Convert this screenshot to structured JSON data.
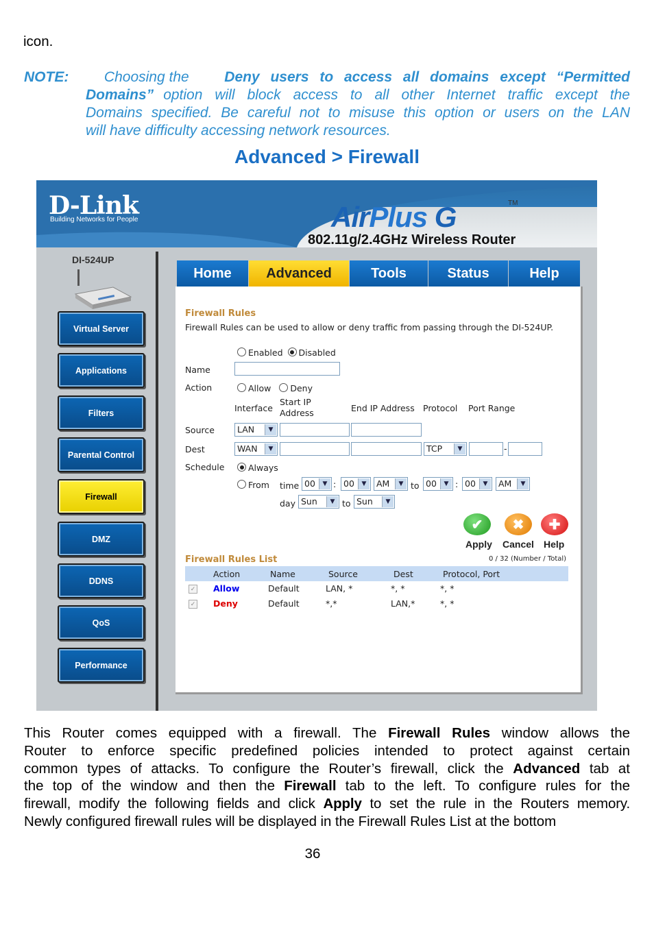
{
  "doc": {
    "top_fragment": "icon.",
    "note_label": "NOTE:",
    "note_line1_a": "Choosing the",
    "note_line1_b": "Deny users to access all domains except “Permitted",
    "note_line2_a": "Domains”",
    "note_line2_b": "option will block access to all other Internet traffic except the",
    "note_line3": "Domains specified. Be careful not to misuse this option or users on the LAN",
    "note_line4": "will have difficulty accessing network resources.",
    "section_title": "Advanced > Firewall",
    "para": {
      "l1_a": "This Router comes equipped with a firewall. The",
      "l1_b": "Firewall Rules",
      "l1_c": "window allows the",
      "l2": "Router to enforce specific predefined policies intended to protect against certain",
      "l3_a": "common types of attacks. To configure the Router’s firewall, click the",
      "l3_b": "Advanced",
      "l3_c": "tab at",
      "l4_a": "the top of the window and then the",
      "l4_b": "Firewall",
      "l4_c": "tab to the left. To configure rules for the",
      "l5_a": "firewall, modify the following fields and click",
      "l5_b": "Apply",
      "l5_c": "to set the rule in the Routers memory.",
      "l6": "Newly configured firewall rules will be displayed in the Firewall Rules List at the bottom"
    },
    "page_number": "36"
  },
  "router": {
    "logo": "D-Link",
    "slogan": "Building Networks for People",
    "brand_a": "Air",
    "brand_b": "Plus",
    "brand_c": "G",
    "tm": "TM",
    "subtitle": "802.11g/2.4GHz Wireless Router",
    "model": "DI-524UP",
    "tabs": [
      "Home",
      "Advanced",
      "Tools",
      "Status",
      "Help"
    ],
    "sidebar": [
      "Virtual Server",
      "Applications",
      "Filters",
      "Parental Control",
      "Firewall",
      "DMZ",
      "DDNS",
      "QoS",
      "Performance"
    ],
    "form": {
      "section": "Firewall Rules",
      "description": "Firewall Rules can be used to allow or deny traffic from passing through the DI-524UP.",
      "enabled": "Enabled",
      "disabled": "Disabled",
      "name_label": "Name",
      "action_label": "Action",
      "allow": "Allow",
      "deny": "Deny",
      "col_interface": "Interface",
      "col_start_ip_1": "Start IP",
      "col_start_ip_2": "Address",
      "col_end_ip": "End IP Address",
      "col_protocol": "Protocol",
      "col_port_range": "Port Range",
      "source_label": "Source",
      "source_iface": "LAN",
      "dest_label": "Dest",
      "dest_iface": "WAN",
      "protocol": "TCP",
      "port_dash": "-",
      "schedule_label": "Schedule",
      "always": "Always",
      "from": "From",
      "time": "time",
      "h1": "00",
      "m1": "00",
      "ampm1": "AM",
      "to": "to",
      "h2": "00",
      "m2": "00",
      "ampm2": "AM",
      "colon": ":",
      "day": "day",
      "day_from": "Sun",
      "day_to": "Sun"
    },
    "actions": {
      "apply": "Apply",
      "cancel": "Cancel",
      "help": "Help"
    },
    "list": {
      "title": "Firewall Rules List",
      "count": "0 / 32 (Number / Total)",
      "headers": [
        "Action",
        "Name",
        "Source",
        "Dest",
        "Protocol, Port"
      ],
      "rows": [
        {
          "action": "Allow",
          "name": "Default",
          "source": "LAN, *",
          "dest": "*, *",
          "proto": "*, *"
        },
        {
          "action": "Deny",
          "name": "Default",
          "source": "*,*",
          "dest": "LAN,*",
          "proto": "*, *"
        }
      ]
    },
    "colors": {
      "allow": "#0000ee",
      "deny": "#dd0000",
      "accent": "#1b63b5"
    }
  }
}
